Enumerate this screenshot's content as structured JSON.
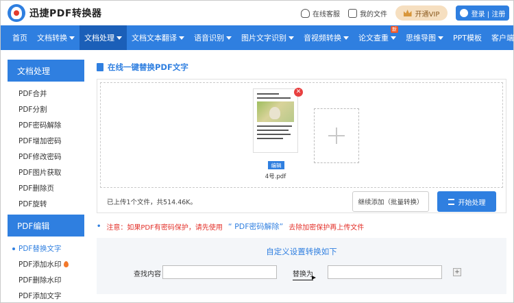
{
  "header": {
    "app_name": "迅捷PDF转换器",
    "online_service": "在线客服",
    "my_files": "我的文件",
    "vip_label": "开通VIP",
    "login_label": "登录 | 注册"
  },
  "nav": {
    "items": [
      {
        "label": "首页",
        "has_caret": false
      },
      {
        "label": "文档转换",
        "has_caret": true
      },
      {
        "label": "文档处理",
        "has_caret": true,
        "active": true
      },
      {
        "label": "文档文本翻译",
        "has_caret": true
      },
      {
        "label": "语音识别",
        "has_caret": true
      },
      {
        "label": "图片文字识别",
        "has_caret": true
      },
      {
        "label": "音视频转换",
        "has_caret": true
      },
      {
        "label": "论文查重",
        "has_caret": true,
        "badge": "新"
      },
      {
        "label": "思维导图",
        "has_caret": true
      },
      {
        "label": "PPT模板",
        "has_caret": false
      },
      {
        "label": "客户端",
        "has_caret": true
      }
    ]
  },
  "sidebar": {
    "section1_title": "文档处理",
    "section1_items": [
      "PDF合并",
      "PDF分割",
      "PDF密码解除",
      "PDF增加密码",
      "PDF修改密码",
      "PDF图片获取",
      "PDF删除页",
      "PDF旋转"
    ],
    "section2_title": "PDF编辑",
    "section2_items": [
      {
        "label": "PDF替换文字",
        "active": true
      },
      {
        "label": "PDF添加水印",
        "hot": true
      },
      {
        "label": "PDF删除水印"
      },
      {
        "label": "PDF添加文字"
      }
    ]
  },
  "main": {
    "title": "在线一键替换PDF文字",
    "file_name": "4号.pdf",
    "edit_label": "编辑",
    "upload_status": "已上传1个文件，共514.46K。",
    "continue_button": "继续添加（批量转换）",
    "start_button": "开始处理",
    "notice_prefix": "注意：如果PDF有密码保护，请先使用",
    "notice_link": "“ PDF密码解除”",
    "notice_suffix": "去除加密保护再上传文件",
    "settings_title": "自定义设置转换如下",
    "find_label": "查找内容",
    "find_value": "",
    "replace_label": "替换为",
    "replace_value": "",
    "add_rule": "+"
  },
  "colors": {
    "primary": "#2f7fe0",
    "nav_active": "#1b5fb8",
    "warning": "#e3312a"
  }
}
